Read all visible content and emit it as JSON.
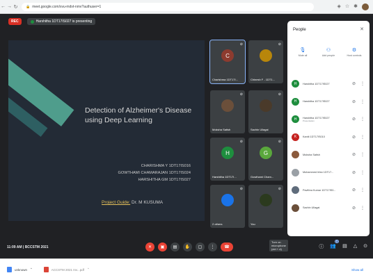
{
  "browser": {
    "url": "meet.google.com/xvu-mdvt-nmv?authuser=1",
    "extensions": [
      "shield-icon",
      "star-icon",
      "puzzle-icon"
    ]
  },
  "meet": {
    "rec_label": "REC",
    "presenting_label": "Harshitha 1DT17IS027 is presenting",
    "slide": {
      "title": "Detection of Alzheimer's Disease using Deep Learning",
      "authors": [
        "CHARISHMA Y 1DT17IS016",
        "GOWTHAMI CHAMARAJAN 1DT17IS024",
        "HARSHITHA GM 1DT17IS027"
      ],
      "guide_label": "Project Guide:",
      "guide_name": "Dr. M KUSUMA"
    },
    "tiles": [
      {
        "name": "Charishma 1DT17I...",
        "initial": "C",
        "color": "#8d3b2f",
        "active": true
      },
      {
        "name": "Chinesh F - 1DT1...",
        "initial": "",
        "color": "#b8860b"
      },
      {
        "name": "Moksha Satish",
        "initial": "",
        "color": "#6b4f3a"
      },
      {
        "name": "Sachin Ullagai",
        "initial": "",
        "color": "#4a3a2a"
      },
      {
        "name": "Harshitha 1DT17I...",
        "initial": "H",
        "color": "#1e8e3e"
      },
      {
        "name": "Gowthami Cham...",
        "initial": "G",
        "color": "#5aa83c"
      },
      {
        "name": "2 others",
        "initial": "",
        "color": "#1a73e8"
      },
      {
        "name": "You",
        "initial": "",
        "color": "#2b3a1e"
      }
    ],
    "time": "11:09 AM",
    "meeting_code": "BCCSTM 2021",
    "tooltip": "Turn on microphone (ctrl + d)",
    "controls": [
      "mic-off-icon",
      "camera-off-icon",
      "captions-icon",
      "hand-icon",
      "present-icon",
      "more-icon",
      "end-call-icon"
    ],
    "right_controls": [
      "info-icon",
      "people-icon",
      "chat-icon",
      "activities-icon",
      "lock-icon"
    ],
    "people_count": "12"
  },
  "people_panel": {
    "title": "People",
    "actions": [
      {
        "label": "Mute all",
        "icon": "mute-all-icon"
      },
      {
        "label": "Add people",
        "icon": "add-person-icon"
      },
      {
        "label": "Host controls",
        "icon": "host-controls-icon"
      }
    ],
    "participants": [
      {
        "name": "Harshitha 1DT17IS027",
        "initial": "H",
        "color": "#1e8e3e",
        "sub": ""
      },
      {
        "name": "Harshitha 1DT17IS027",
        "initial": "H",
        "color": "#1e8e3e",
        "sub": ""
      },
      {
        "name": "Harshitha 1DT17IS027",
        "initial": "H",
        "color": "#1e8e3e",
        "sub": "Presentation"
      },
      {
        "name": "Kaniti 1DT17IS010",
        "initial": "K",
        "color": "#c5221f",
        "sub": ""
      },
      {
        "name": "Moksha Satish",
        "initial": "",
        "color": "#8b5a3c",
        "sub": ""
      },
      {
        "name": "Mohammed Irfan 1DT17...",
        "initial": "",
        "color": "#9aa0a6",
        "sub": ""
      },
      {
        "name": "Pavithra Kumar 1DT17IS0...",
        "initial": "",
        "color": "#5f6c7b",
        "sub": ""
      },
      {
        "name": "Sachin Ullagai",
        "initial": "",
        "color": "#6b4f3a",
        "sub": ""
      }
    ]
  },
  "downloads": {
    "items": [
      {
        "label": "unknown",
        "type": "file"
      },
      {
        "label": "ACCSTM 2021 Inv...pdf",
        "type": "pdf"
      }
    ],
    "show_all": "Show all"
  }
}
